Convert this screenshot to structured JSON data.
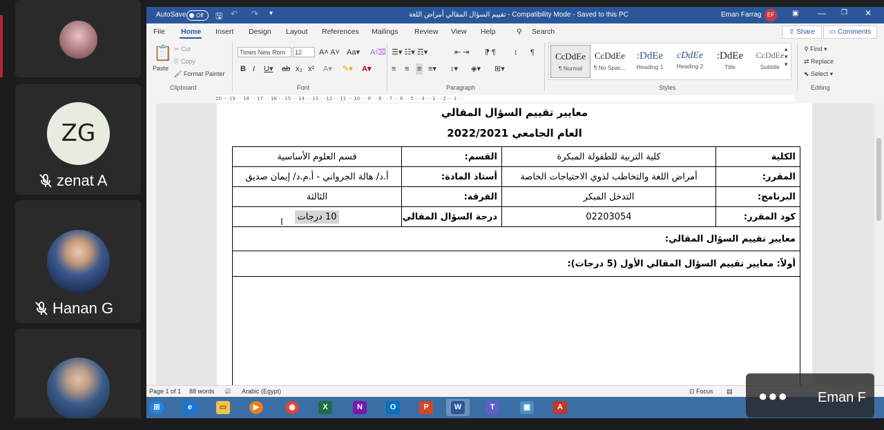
{
  "meeting": {
    "participants": [
      {
        "name": "",
        "initials": ""
      },
      {
        "name": "zenat A",
        "initials": "ZG"
      },
      {
        "name": "Hanan G",
        "initials": ""
      },
      {
        "name": "",
        "initials": ""
      }
    ],
    "overlay_name": "Eman F"
  },
  "word": {
    "titlebar": {
      "autosave": "AutoSave",
      "autosave_state": "Off",
      "doc_title": "تقييم السؤال المقالي أمراض اللغة - Compatibility Mode - Saved to this PC",
      "user": "Eman Farrag",
      "user_initials": "EF"
    },
    "tabs": [
      "File",
      "Home",
      "Insert",
      "Design",
      "Layout",
      "References",
      "Mailings",
      "Review",
      "View",
      "Help"
    ],
    "search_label": "Search",
    "share_label": "Share",
    "comments_label": "Comments",
    "ribbon": {
      "paste": "Paste",
      "cut": "Cut",
      "copy": "Copy",
      "format_painter": "Format Painter",
      "clipboard": "Clipboard",
      "font_name": "Times New Rom",
      "font_size": "12",
      "font": "Font",
      "paragraph": "Paragraph",
      "styles_label": "Styles",
      "editing": "Editing",
      "find": "Find",
      "replace": "Replace",
      "select": "Select",
      "styles": [
        {
          "preview": "CcDdEe",
          "name": "¶ Normal"
        },
        {
          "preview": "CcDdEe",
          "name": "¶ No Spac..."
        },
        {
          "preview": ":DdEe",
          "name": "Heading 1"
        },
        {
          "preview": "cDdEe",
          "name": "Heading 2"
        },
        {
          "preview": ":DdEe",
          "name": "Title"
        },
        {
          "preview": "CcDdEe",
          "name": "Subtitle"
        }
      ]
    },
    "ruler_ticks": "20 · · 19 · · 18 · · 17 · · 16 · · 15 · · 14 · · 13 · · 12 · · 11 · · 10 · · 9 · · 8 · · 7 · · 6 · · 5 · · 4 · · 3 · · 2 · · 1 · ·",
    "document": {
      "heading1": "معايير تقييم السؤال المقالي",
      "heading2": "العام الجامعي 2022/2021",
      "rows": [
        {
          "k1": "الكلية",
          "v1": "كلية التربية للطفولة المبكرة",
          "k2": "القسم:",
          "v2": "قسم العلوم الأساسية"
        },
        {
          "k1": "المقرر:",
          "v1": "أمراض اللغة والتخاطب لذوي الاحتياجات الخاصة",
          "k2": "أستاذ المادة:",
          "v2": "أ.د/ هالة الجرواني - أ.م.د/ إيمان صديق"
        },
        {
          "k1": "البرنامج:",
          "v1": "التدخل المبكر",
          "k2": "الفرقة:",
          "v2": "الثالثة"
        },
        {
          "k1": "كود المقرر:",
          "v1": "02203054",
          "k2": "درجة السؤال المقالي",
          "v2": "10 درجات"
        }
      ],
      "section1": "معايير تقييم السؤال المقالي:",
      "section2": "أولاً: معايير تقييم السؤال المقالي الأول (5 درجات):"
    },
    "status": {
      "page": "Page 1 of 1",
      "words": "88 words",
      "language": "Arabic (Egypt)",
      "focus": "Focus"
    },
    "taskbar_apps": [
      {
        "name": "windows-start",
        "glyph": "⊞",
        "color": "#1e88e5"
      },
      {
        "name": "internet-explorer",
        "glyph": "e",
        "color": "#1976d2"
      },
      {
        "name": "file-explorer",
        "glyph": "▭",
        "color": "#f2c14e"
      },
      {
        "name": "media-player",
        "glyph": "▶",
        "color": "#e67e22"
      },
      {
        "name": "chrome",
        "glyph": "◉",
        "color": "#db4437"
      },
      {
        "name": "excel",
        "glyph": "X",
        "color": "#1d6f42"
      },
      {
        "name": "onenote",
        "glyph": "N",
        "color": "#7719aa"
      },
      {
        "name": "outlook",
        "glyph": "O",
        "color": "#0072c6"
      },
      {
        "name": "powerpoint",
        "glyph": "P",
        "color": "#d24726"
      },
      {
        "name": "word",
        "glyph": "W",
        "color": "#2b579a"
      },
      {
        "name": "teams",
        "glyph": "T",
        "color": "#5b5fc7"
      },
      {
        "name": "photos",
        "glyph": "▣",
        "color": "#4a90c2"
      },
      {
        "name": "acrobat",
        "glyph": "A",
        "color": "#c0392b"
      }
    ]
  }
}
